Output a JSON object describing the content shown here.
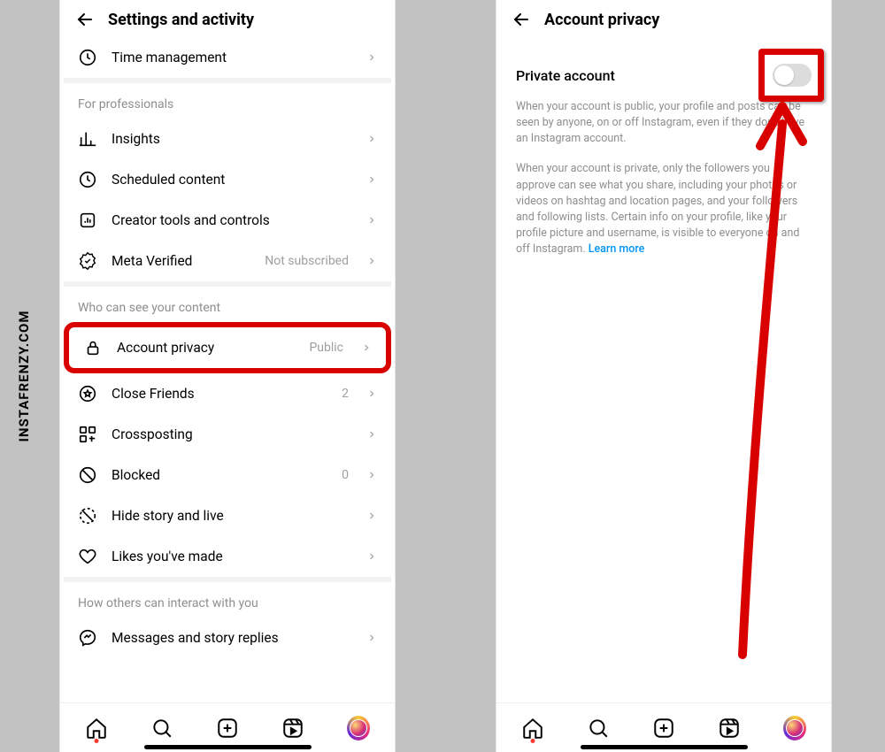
{
  "watermark": "INSTAFRENZY.COM",
  "left": {
    "title": "Settings and activity",
    "topRow": {
      "label": "Time management"
    },
    "section1": {
      "title": "For professionals",
      "items": [
        {
          "label": "Insights"
        },
        {
          "label": "Scheduled content"
        },
        {
          "label": "Creator tools and controls"
        },
        {
          "label": "Meta Verified",
          "badge": "Not subscribed"
        }
      ]
    },
    "section2": {
      "title": "Who can see your content",
      "items": [
        {
          "label": "Account privacy",
          "badge": "Public"
        },
        {
          "label": "Close Friends",
          "badge": "2"
        },
        {
          "label": "Crossposting"
        },
        {
          "label": "Blocked",
          "badge": "0"
        },
        {
          "label": "Hide story and live"
        },
        {
          "label": "Likes you've made"
        }
      ]
    },
    "section3": {
      "title": "How others can interact with you",
      "items": [
        {
          "label": "Messages and story replies"
        }
      ]
    }
  },
  "right": {
    "title": "Account privacy",
    "toggleLabel": "Private account",
    "desc1": "When your account is public, your profile and posts can be seen by anyone, on or off Instagram, even if they don't have an Instagram account.",
    "desc2": "When your account is private, only the followers you approve can see what you share, including your photos or videos on hashtag and location pages, and your followers and following lists. Certain info on your profile, like your profile picture and username, is visible to everyone on and off Instagram. ",
    "learnMore": "Learn more"
  }
}
